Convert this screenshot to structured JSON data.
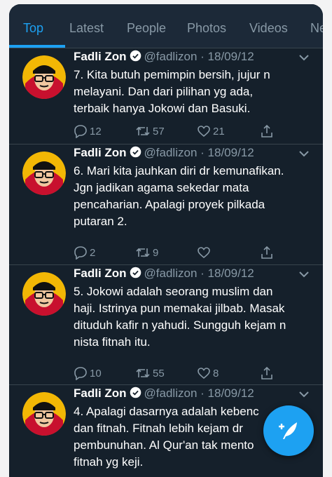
{
  "tabs": [
    {
      "label": "Top",
      "active": true
    },
    {
      "label": "Latest",
      "active": false
    },
    {
      "label": "People",
      "active": false
    },
    {
      "label": "Photos",
      "active": false
    },
    {
      "label": "Videos",
      "active": false
    },
    {
      "label": "Ne",
      "active": false
    }
  ],
  "tweets": [
    {
      "name": "Fadli Zon",
      "handle": "@fadlizon",
      "separator": "·",
      "date": "18/09/12",
      "lines": [
        "7. Kita butuh pemimpin bersih, jujur n",
        "melayani. Dan dari pilihan yg ada,",
        "terbaik hanya Jokowi dan Basuki."
      ],
      "replies": "12",
      "retweets": "57",
      "likes": "21"
    },
    {
      "name": "Fadli Zon",
      "handle": "@fadlizon",
      "separator": "·",
      "date": "18/09/12",
      "lines": [
        "6. Mari kita jauhkan diri dr kemunafikan.",
        "Jgn jadikan agama sekedar mata",
        "pencaharian. Apalagi proyek pilkada",
        "putaran 2."
      ],
      "replies": "2",
      "retweets": "9",
      "likes": ""
    },
    {
      "name": "Fadli Zon",
      "handle": "@fadlizon",
      "separator": "·",
      "date": "18/09/12",
      "lines": [
        "5. Jokowi adalah seorang muslim dan",
        "haji. Istrinya pun memakai jilbab. Masak",
        "dituduh kafir n yahudi. Sungguh kejam n",
        "nista fitnah itu."
      ],
      "replies": "10",
      "retweets": "55",
      "likes": "8"
    },
    {
      "name": "Fadli Zon",
      "handle": "@fadlizon",
      "separator": "·",
      "date": "18/09/12",
      "lines": [
        "4. Apalagi dasarnya adalah kebenc",
        "dan fitnah. Fitnah lebih kejam dr",
        "pembunuhan. Al Qur'an tak mento",
        "fitnah yg keji."
      ],
      "replies": "",
      "retweets": "",
      "likes": ""
    }
  ],
  "icons": {
    "reply": "reply-icon",
    "retweet": "retweet-icon",
    "like": "heart-icon",
    "share": "share-icon",
    "verified": "verified-badge-icon",
    "caret": "chevron-down-icon",
    "compose": "compose-tweet-icon"
  },
  "colors": {
    "background": "#15202b",
    "accent": "#1da1f2",
    "secondary_text": "#8899a6",
    "divider": "#38444d"
  }
}
